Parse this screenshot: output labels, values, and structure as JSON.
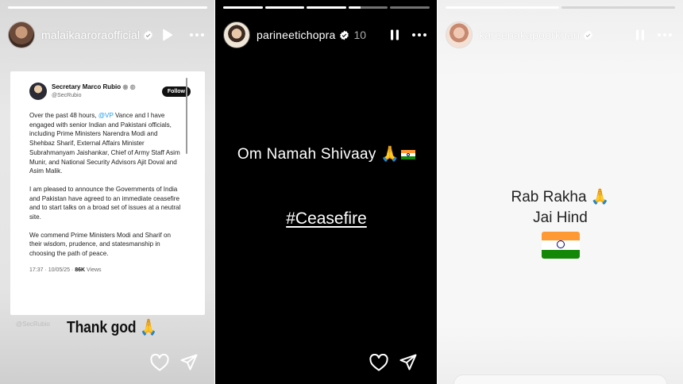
{
  "stories": [
    {
      "username": "malaikaaroraofficial",
      "verified": true,
      "progress": [
        1.0
      ],
      "tweet": {
        "author": "Secretary Marco Rubio",
        "handle": "@SecRubio",
        "follow_label": "Follow",
        "para1_a": "Over the past 48 hours, ",
        "para1_mention": "@VP",
        "para1_b": " Vance and I have engaged with senior Indian and Pakistani officials, including Prime Ministers Narendra Modi and Shehbaz Sharif, External Affairs Minister Subrahmanyam Jaishankar, Chief of Army Staff Asim Munir, and National Security Advisors Ajit Doval and Asim Malik.",
        "para2": "I am pleased to announce the Governments of India and Pakistan have agreed to an immediate ceasefire and to start talks on a broad set of issues at a neutral site.",
        "para3": "We commend Prime Ministers Modi and Sharif on their wisdom, prudence, and statesmanship in choosing the path of peace.",
        "time": "17:37 · 10/05/25 · ",
        "views_count": "86K",
        "views_label": " Views"
      },
      "watermark": "@SecRubio",
      "caption_text": "Thank god ",
      "caption_emoji": "🙏"
    },
    {
      "username": "parineetichopra",
      "verified": true,
      "timestamp": "10",
      "progress": [
        1.0,
        1.0,
        1.0,
        0.3,
        0.0
      ],
      "line1": "Om Namah Shivaay ",
      "line1_emoji": "🙏",
      "line2": "#Ceasefire"
    },
    {
      "username": "kareenakapoorkhan",
      "verified": true,
      "progress": [
        1.0,
        0.0
      ],
      "line1": "Rab Rakha ",
      "line1_emoji": "🙏",
      "line2": "Jai Hind"
    }
  ],
  "colors": {
    "dark_bg": "#000000",
    "verified_blue": "#3897f0",
    "mention_blue": "#1d9bf0",
    "emoji_gold": "#f0a330",
    "flag_saffron": "#ff9933",
    "flag_green": "#138808",
    "chakra_navy": "#000080"
  },
  "icons": [
    "play-icon",
    "pause-icon",
    "more-icon",
    "heart-icon",
    "send-icon",
    "verified-icon",
    "india-flag-icon",
    "folded-hands-icon"
  ]
}
